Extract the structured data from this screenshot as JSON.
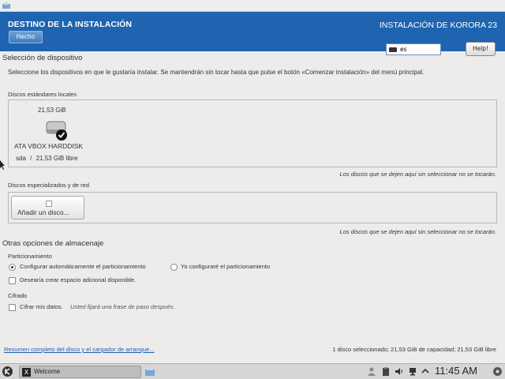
{
  "header": {
    "title": "DESTINO DE LA INSTALACIÓN",
    "done_label": "Hecho",
    "product": "INSTALACIÓN DE KORORA 23",
    "keyboard_layout": "es",
    "help_label": "Help!"
  },
  "device_selection": {
    "title": "Selección de dispositivo",
    "description": "Seleccione los dispositivos en que le gustaría instalar. Se mantendrán sin tocar hasta que pulse el botón «Comenzar instalación» del menú principal.",
    "local_disks_label": "Discos estándares locales",
    "disk": {
      "size": "21,53 GiB",
      "name": "ATA VBOX HARDDISK",
      "device": "sda",
      "separator": "/",
      "free": "21,53 GiB libre"
    },
    "local_note": "Los discos que se dejen aquí sin seleccionar no se tocarán.",
    "network_disks_label": "Discos especializados y de red",
    "add_disk_label": "Añadir un disco...",
    "network_note": "Los discos que se dejen aquí sin seleccionar no se tocarán."
  },
  "storage_options": {
    "title": "Otras opciones de almacenaje",
    "partitioning_label": "Particionamiento",
    "radio_auto": "Configurar automáticamente el particionamiento",
    "radio_manual": "Yo configuraré el particionamiento",
    "selected_radio": "auto",
    "extra_space_label": "Desearía crear espacio adicional disponible.",
    "encryption_label": "Cifrado",
    "encrypt_label": "Cifrar mis datos.",
    "encrypt_hint": "Usted fijará una frase de paso después."
  },
  "footer": {
    "summary_link": "Resumen completo del disco y el cargador de arranque...",
    "status": "1 disco seleccionado; 21,53 GiB de capacidad; 21,53 GiB libre"
  },
  "taskbar": {
    "task_label": "Welcome",
    "clock": "11:45 AM"
  },
  "colors": {
    "header_bg": "#1e64b0",
    "link": "#1e5fb5"
  }
}
